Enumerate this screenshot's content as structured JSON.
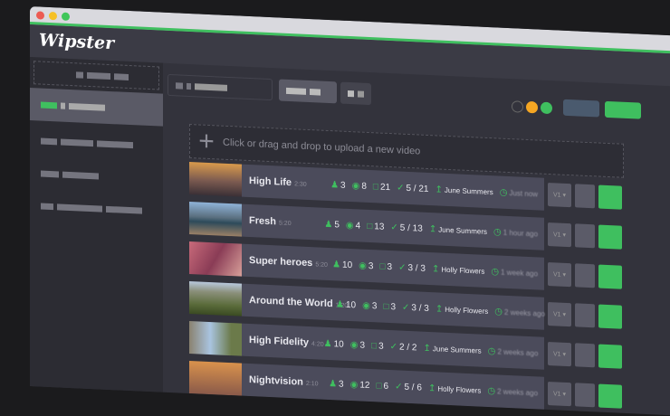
{
  "app": {
    "logo": "Wipster"
  },
  "upload": {
    "placeholder": "Click or drag and drop to upload a new video",
    "icon": "plus-icon"
  },
  "colors": {
    "accent": "#3fbf5f",
    "orange": "#f5a623",
    "red": "#ec5b52"
  },
  "videos": [
    {
      "title": "High Life",
      "duration": "2:30",
      "reviewers": "3",
      "views": "8",
      "comments": "21",
      "approved": "5 / 21",
      "uploader": "June Summers",
      "time": "Just now",
      "thumb": "linear-gradient(#d99a4c,#7b5a50 55%,#3b3036)"
    },
    {
      "title": "Fresh",
      "duration": "5:20",
      "reviewers": "5",
      "views": "4",
      "comments": "13",
      "approved": "5 / 13",
      "uploader": "June Summers",
      "time": "1 hour ago",
      "thumb": "linear-gradient(#8fb3d8,#5a6f7f 45%,#2d4a5a 60%,#9a8066)"
    },
    {
      "title": "Super heroes",
      "duration": "5:20",
      "reviewers": "10",
      "views": "3",
      "comments": "3",
      "approved": "3 / 3",
      "uploader": "Holly Flowers",
      "time": "1 week ago",
      "thumb": "linear-gradient(120deg,#c86a7a,#8a3c56 50%,#d8a09a)"
    },
    {
      "title": "Around the World",
      "duration": "1:20",
      "reviewers": "10",
      "views": "3",
      "comments": "3",
      "approved": "3 / 3",
      "uploader": "Holly Flowers",
      "time": "2 weeks ago",
      "thumb": "linear-gradient(#b8c8dc,#8a8f7a 30%,#5a6b3a 70%,#3a4a22)"
    },
    {
      "title": "High Fidelity",
      "duration": "4:20",
      "reviewers": "10",
      "views": "3",
      "comments": "3",
      "approved": "2 / 2",
      "uploader": "June Summers",
      "time": "2 weeks ago",
      "thumb": "linear-gradient(90deg,#8a8270,#a9c4e0 40%,#6b7a4a 80%)"
    },
    {
      "title": "Nightvision",
      "duration": "2:10",
      "reviewers": "3",
      "views": "12",
      "comments": "6",
      "approved": "5 / 6",
      "uploader": "Holly Flowers",
      "time": "2 weeks ago",
      "thumb": "linear-gradient(#d9924c,#8a5a4a)"
    }
  ]
}
